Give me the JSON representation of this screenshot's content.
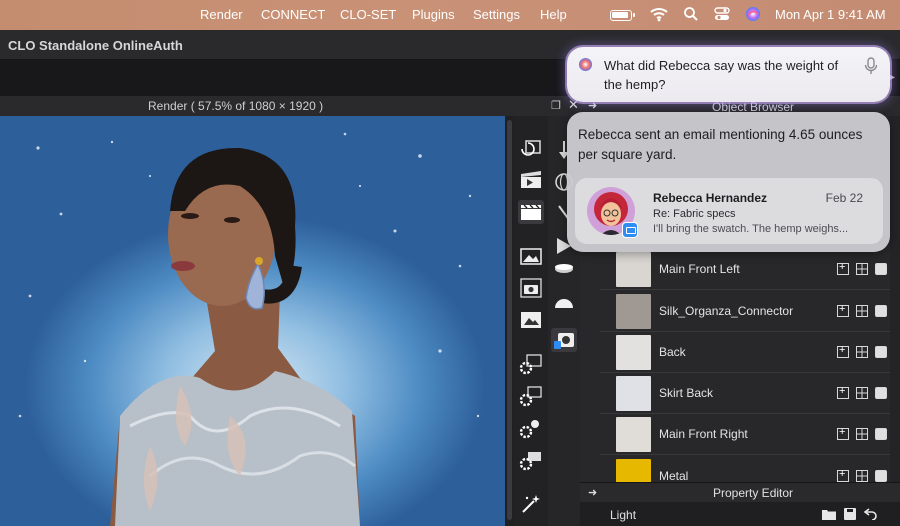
{
  "menubar": {
    "items": [
      "Render",
      "CONNECT",
      "CLO-SET",
      "Plugins",
      "Settings",
      "Help"
    ],
    "datetime": "Mon Apr 1  9:41 AM",
    "status_icons": [
      "battery-icon",
      "wifi-icon",
      "spotlight-search-icon",
      "control-center-icon",
      "siri-icon"
    ]
  },
  "app": {
    "title": "CLO Standalone OnlineAuth"
  },
  "render_panel": {
    "header": "Render ( 57.5% of 1080 × 1920 )"
  },
  "object_browser": {
    "header": "Object Browser",
    "items": [
      {
        "name": "Main Front Left",
        "thumb_color": "#d9d6d2"
      },
      {
        "name": "Silk_Organza_Connector",
        "thumb_color": "#a09893"
      },
      {
        "name": "Back",
        "thumb_color": "#e2e1df"
      },
      {
        "name": "Skirt Back",
        "thumb_color": "#dfe1e6"
      },
      {
        "name": "Main Front Right",
        "thumb_color": "#e0ddd9"
      },
      {
        "name": "Metal",
        "thumb_color": "#e6b800"
      }
    ]
  },
  "property_editor": {
    "header": "Property Editor",
    "value": "Light"
  },
  "siri": {
    "query": "What did Rebecca say was the weight of the hemp?",
    "answer": "Rebecca sent an email mentioning 4.65 ounces per square yard.",
    "email": {
      "sender": "Rebecca Hernandez",
      "date": "Feb 22",
      "subject": "Re: Fabric specs",
      "preview": "I'll bring the swatch. The hemp weighs..."
    }
  },
  "colors": {
    "menubar": "#c99176",
    "app_background": "#1e1e20",
    "panel_header": "#2a2a2d",
    "siri_glow": "#d6b4ff",
    "mail_badge": "#2f8cf2"
  }
}
